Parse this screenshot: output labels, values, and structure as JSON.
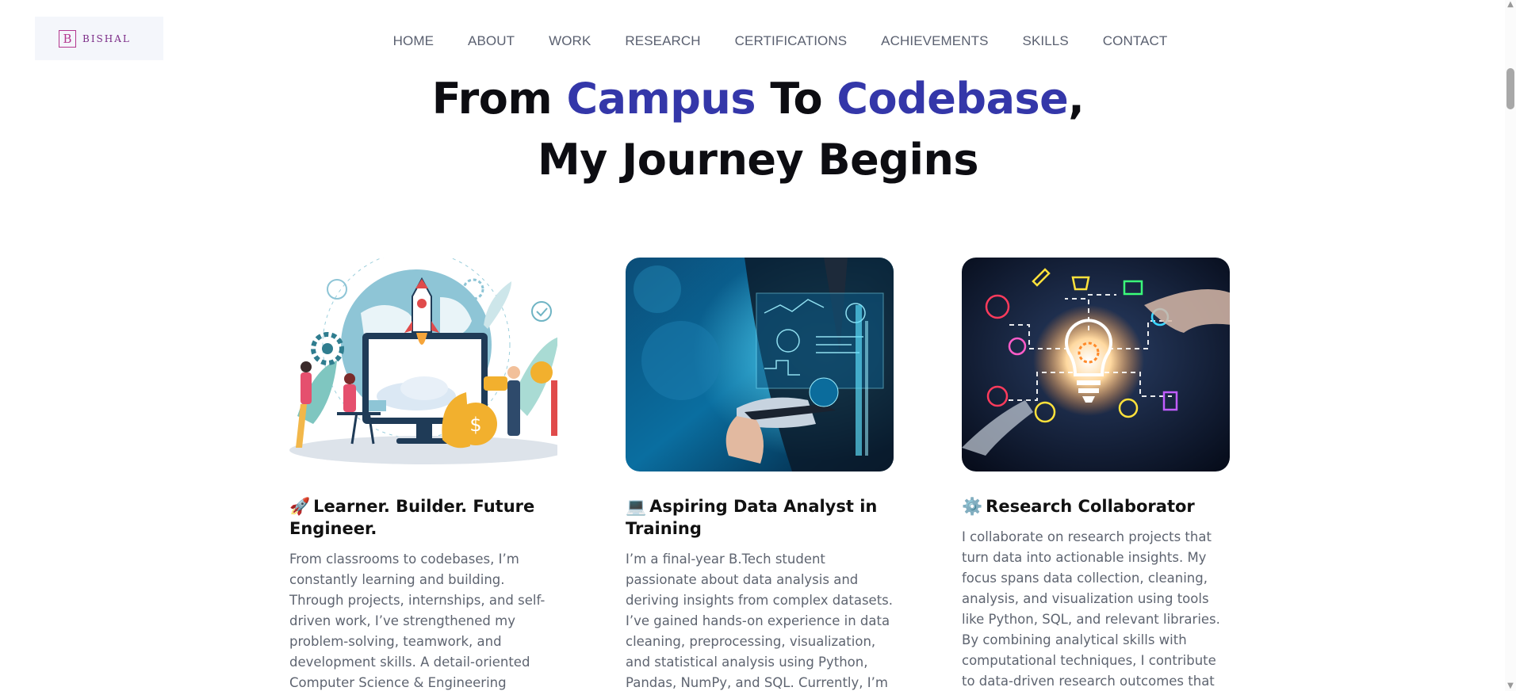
{
  "logo": {
    "mark": "B",
    "text": "BISHAL"
  },
  "nav": [
    {
      "label": "HOME"
    },
    {
      "label": "ABOUT"
    },
    {
      "label": "WORK"
    },
    {
      "label": "RESEARCH"
    },
    {
      "label": "CERTIFICATIONS"
    },
    {
      "label": "ACHIEVEMENTS"
    },
    {
      "label": "SKILLS"
    },
    {
      "label": "CONTACT"
    }
  ],
  "hero": {
    "w1": "From",
    "w2": "Campus",
    "w3": "To",
    "w4": "Codebase",
    "comma": ",",
    "line2": "My Journey Begins"
  },
  "cards": [
    {
      "icon": "rocket-icon",
      "emoji": "🚀",
      "title": "Learner. Builder. Future Engineer.",
      "text": "From classrooms to codebases, I’m constantly learning and building. Through projects, internships, and self-driven work, I’ve strengthened my problem-solving, teamwork, and development skills. A detail-oriented Computer Science & Engineering student, I’m passionate about"
    },
    {
      "icon": "laptop-icon",
      "emoji": "💻",
      "title": "Aspiring Data Analyst in Training",
      "text": "I’m a final-year B.Tech student passionate about data analysis and deriving insights from complex datasets. I’ve gained hands-on experience in data cleaning, preprocessing, visualization, and statistical analysis using Python, Pandas, NumPy, and SQL. Currently, I’m deepening"
    },
    {
      "icon": "gear-icon",
      "emoji": "⚙️",
      "title": "Research Collaborator",
      "text": "I collaborate on research projects that turn data into actionable insights. My focus spans data collection, cleaning, analysis, and visualization using tools like Python, SQL, and relevant libraries. By combining analytical skills with computational techniques, I contribute to data-driven research outcomes that are"
    }
  ],
  "colors": {
    "accent": "#3437a9",
    "nav_text": "#5a6070",
    "body_text": "#5e6470",
    "logo": "#b3378f"
  }
}
